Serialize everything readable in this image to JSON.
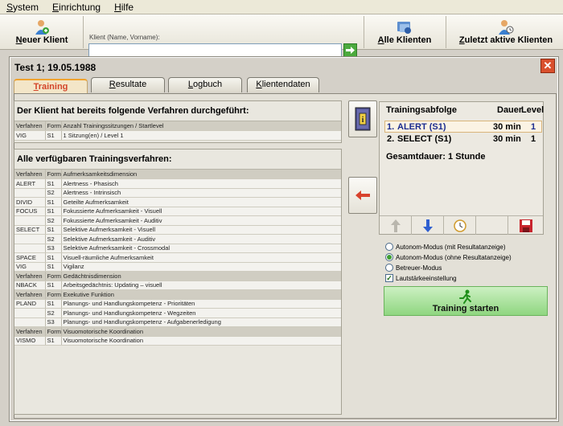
{
  "menu": {
    "items": [
      {
        "pre": "",
        "ul": "S",
        "post": "ystem"
      },
      {
        "pre": "",
        "ul": "E",
        "post": "inrichtung"
      },
      {
        "pre": "",
        "ul": "H",
        "post": "ilfe"
      }
    ]
  },
  "toolbar": {
    "new_client": {
      "ul": "N",
      "post": "euer Klient"
    },
    "client_label": "Klient (Name, Vorname):",
    "client_value": "",
    "all_clients": {
      "ul": "A",
      "post": "lle Klienten"
    },
    "recent_clients": {
      "ul": "Z",
      "post": "uletzt aktive Klienten"
    }
  },
  "dialog": {
    "title": "Test 1; 19.05.1988",
    "close": "✕",
    "tabs": [
      {
        "ul": "T",
        "post": "raining",
        "active": true
      },
      {
        "ul": "R",
        "post": "esultate",
        "active": false
      },
      {
        "ul": "L",
        "post": "ogbuch",
        "active": false
      },
      {
        "ul": "K",
        "post": "lientendaten",
        "active": false
      }
    ]
  },
  "performed": {
    "title": "Der Klient hat bereits folgende Verfahren durchgeführt:",
    "headers": [
      "Verfahren",
      "Form",
      "Anzahl Trainingssitzungen / Startlevel"
    ],
    "rows": [
      [
        "VIG",
        "S1",
        "1 Sitzung(en) / Level 1"
      ]
    ]
  },
  "available": {
    "title": "Alle verfügbaren Trainingsverfahren:",
    "rows": [
      {
        "type": "hdr",
        "cells": [
          "Verfahren",
          "Form",
          "Aufmerksamkeitsdimension"
        ]
      },
      {
        "type": "row",
        "cells": [
          "ALERT",
          "S1",
          "Alertness - Phasisch"
        ]
      },
      {
        "type": "row",
        "cells": [
          "",
          "S2",
          "Alertness - Intrinsisch"
        ]
      },
      {
        "type": "row",
        "cells": [
          "DIVID",
          "S1",
          "Geteilte Aufmerksamkeit"
        ]
      },
      {
        "type": "row",
        "cells": [
          "FOCUS",
          "S1",
          "Fokussierte Aufmerksamkeit - Visuell"
        ]
      },
      {
        "type": "row",
        "cells": [
          "",
          "S2",
          "Fokussierte Aufmerksamkeit - Auditiv"
        ]
      },
      {
        "type": "row",
        "cells": [
          "SELECT",
          "S1",
          "Selektive Aufmerksamkeit - Visuell"
        ]
      },
      {
        "type": "row",
        "cells": [
          "",
          "S2",
          "Selektive Aufmerksamkeit - Auditiv"
        ]
      },
      {
        "type": "row",
        "cells": [
          "",
          "S3",
          "Selektive Aufmerksamkeit - Crossmodal"
        ]
      },
      {
        "type": "row",
        "cells": [
          "SPACE",
          "S1",
          "Visuell-räumliche Aufmerksamkeit"
        ]
      },
      {
        "type": "row",
        "cells": [
          "VIG",
          "S1",
          "Vigilanz"
        ]
      },
      {
        "type": "hdr",
        "cells": [
          "Verfahren",
          "Form",
          "Gedächtnisdimension"
        ]
      },
      {
        "type": "row",
        "cells": [
          "NBACK",
          "S1",
          "Arbeitsgedächtnis: Updating – visuell"
        ]
      },
      {
        "type": "hdr",
        "cells": [
          "Verfahren",
          "Form",
          "Exekutive Funktion"
        ]
      },
      {
        "type": "row",
        "cells": [
          "PLAND",
          "S1",
          "Planungs- und Handlungskompetenz - Prioritäten"
        ]
      },
      {
        "type": "row",
        "cells": [
          "",
          "S2",
          "Planungs- und Handlungskompetenz - Wegzeiten"
        ]
      },
      {
        "type": "row",
        "cells": [
          "",
          "S3",
          "Planungs- und Handlungskompetenz - Aufgabenerledigung"
        ]
      },
      {
        "type": "hdr",
        "cells": [
          "Verfahren",
          "Form",
          "Visuomotorische Koordination"
        ]
      },
      {
        "type": "row",
        "cells": [
          "VISMO",
          "S1",
          "Visuomotorische Koordination"
        ]
      }
    ]
  },
  "sequence": {
    "headers": [
      "Trainingsabfolge",
      "Dauer",
      "Level"
    ],
    "rows": [
      {
        "num": "1.",
        "name": "ALERT (S1)",
        "duration": "30 min",
        "level": "1",
        "selected": true
      },
      {
        "num": "2.",
        "name": "SELECT (S1)",
        "duration": "30 min",
        "level": "1",
        "selected": false
      }
    ],
    "total": "Gesamtdauer: 1 Stunde"
  },
  "options": {
    "mode1": "Autonom-Modus (mit Resultatanzeige)",
    "mode2": "Autonom-Modus (ohne Resultatanzeige)",
    "mode3": "Betreuer-Modus",
    "volume": "Lautstärkeeinstellung",
    "selected_mode": 2,
    "volume_checked": true
  },
  "start_button": "Training starten",
  "colors": {
    "accent_tab": "#d3452a",
    "start_green": "#8fd680",
    "selection": "#1b2c8f"
  }
}
